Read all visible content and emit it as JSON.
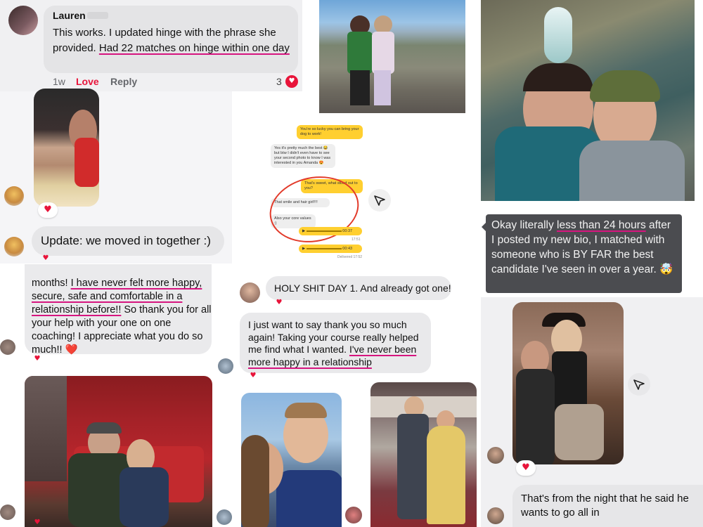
{
  "comment_lauren": {
    "author": "Lauren",
    "text_plain": "This works. I updated hinge with the phrase she provided. ",
    "text_highlight": "Had 22 matches on hinge within one day",
    "time": "1w",
    "love_label": "Love",
    "reply_label": "Reply",
    "like_count": "3"
  },
  "update_message": {
    "text": "Update: we moved in together :)"
  },
  "months_message": {
    "text_start": "months! ",
    "text_highlight": "I have never felt more happy, secure, safe and comfortable in a relationship before!!",
    "text_end": " So thank you for all your help with your one on one coaching! I appreciate what you do so much!!",
    "emoji": "❤️"
  },
  "holy_message": {
    "text": "HOLY SHIT DAY 1. And already got one!"
  },
  "thankyou_message": {
    "text_start": "I just want to say thank you so much again! Taking your course really helped me find what I wanted. ",
    "text_highlight": "I've never been more happy in a relationship"
  },
  "bio_message": {
    "text_start": "Okay literally ",
    "text_highlight": "less than 24 hours",
    "text_end": " after I posted my new bio, I matched with someone who is BY FAR the best candidate I've seen in over a year.",
    "emoji": "🤯"
  },
  "night_message": {
    "text": "That's from the night that he said he wants to go all in"
  },
  "mini_chat": {
    "msg1": "You're so lucky you can bring your dog to work!",
    "msg2": "Yes it's pretty much the best 😂 but btw I didn't even have to see your second photo to know I was interested in you Amanda 😍",
    "msg3": "That's sweet, what stood out to you?",
    "msg4": "That smile and hair girl!!!!",
    "msg5": "Also your core values :)",
    "audio1": "00:37",
    "audio1_time": "17:51",
    "audio2": "00:43",
    "delivered": "Delivered 17:52"
  },
  "icons": {
    "heart": "♥",
    "send": "send-icon"
  },
  "colors": {
    "love_red": "#e8143a",
    "underline_pink": "#d6157f",
    "bio_bubble": "#4b4c50",
    "chat_yellow": "#ffcf30"
  }
}
